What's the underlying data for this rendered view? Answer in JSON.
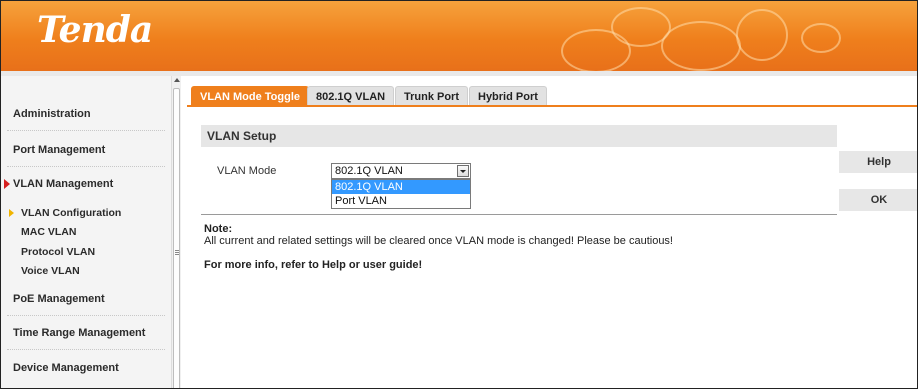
{
  "header": {
    "logo_text": "Tenda",
    "brand_color": "#ef7f1c"
  },
  "sidebar": {
    "items": [
      {
        "label": "Administration"
      },
      {
        "label": "Port Management"
      },
      {
        "label": "VLAN Management",
        "expanded": true
      },
      {
        "label": "PoE Management"
      },
      {
        "label": "Time Range Management"
      },
      {
        "label": "Device Management"
      }
    ],
    "sub_items": [
      {
        "label": "VLAN Configuration",
        "selected": true
      },
      {
        "label": "MAC VLAN"
      },
      {
        "label": "Protocol VLAN"
      },
      {
        "label": "Voice VLAN"
      }
    ]
  },
  "tabs": [
    {
      "label": "VLAN Mode Toggle",
      "active": true
    },
    {
      "label": "802.1Q VLAN"
    },
    {
      "label": "Trunk Port"
    },
    {
      "label": "Hybrid Port"
    }
  ],
  "section": {
    "title": "VLAN Setup"
  },
  "form": {
    "mode_label": "VLAN Mode",
    "mode_value": "802.1Q VLAN",
    "options": [
      "802.1Q VLAN",
      "Port VLAN"
    ]
  },
  "actions": {
    "help_label": "Help",
    "ok_label": "OK"
  },
  "note": {
    "title": "Note:",
    "text": "All current and related settings will be cleared once VLAN mode is changed! Please be cautious!",
    "more": "For more info, refer to Help or user guide!"
  },
  "colors": {
    "accent": "#ef7f1c",
    "selection": "#3399ff",
    "alert_arrow": "#d62020",
    "sub_arrow": "#f0b400"
  }
}
